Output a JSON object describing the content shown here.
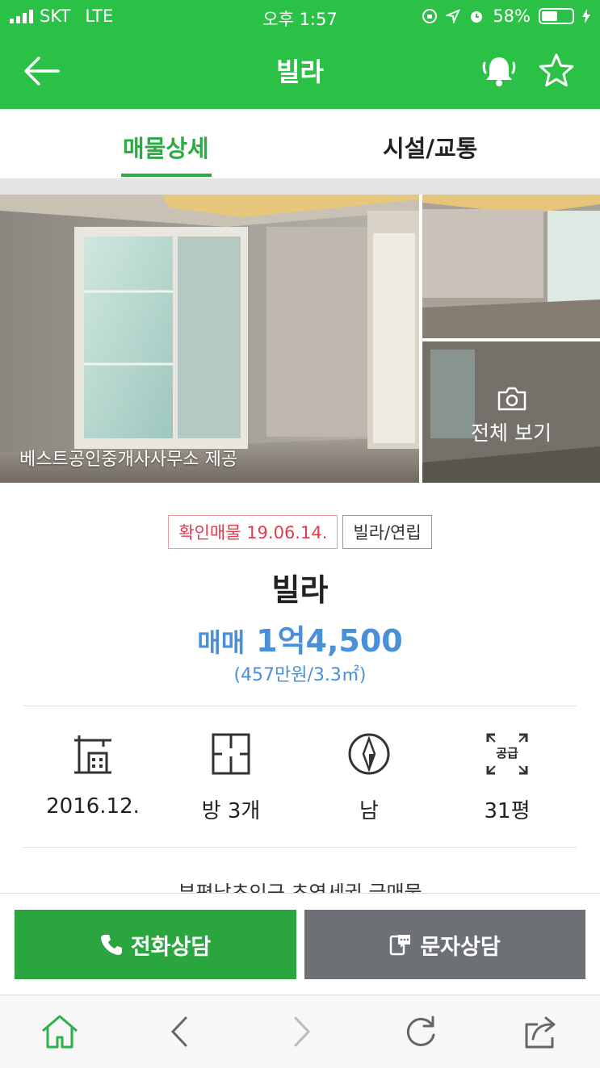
{
  "status": {
    "carrier": "SKT",
    "network": "LTE",
    "time": "오후 1:57",
    "battery": "58%",
    "battery_level": 0.58
  },
  "header": {
    "title": "빌라",
    "bg_color": "#2bc146"
  },
  "tabs": [
    {
      "label": "매물상세",
      "active": true
    },
    {
      "label": "시설/교통",
      "active": false
    }
  ],
  "photos": {
    "credit": "베스트공인중개사사무소 제공",
    "view_all": "전체 보기"
  },
  "listing": {
    "badges": {
      "verified": "확인매물 19.06.14.",
      "type": "빌라/연립"
    },
    "title": "빌라",
    "price_type": "매매",
    "price": "1억4,500",
    "unit_price": "(457만원/3.3㎡)",
    "facts": [
      {
        "icon": "building-icon",
        "value": "2016.12."
      },
      {
        "icon": "floorplan-icon",
        "value": "방 3개"
      },
      {
        "icon": "compass-icon",
        "value": "남"
      },
      {
        "icon": "area-icon",
        "icon_text": "공급",
        "value": "31평"
      }
    ],
    "description": "부평남초인근 초역세권 급매물"
  },
  "actions": {
    "call": "전화상담",
    "sms": "문자상담"
  },
  "colors": {
    "green": "#2bc146",
    "accent": "#2bab41",
    "price": "#4a90d9",
    "red": "#e23c4f"
  }
}
